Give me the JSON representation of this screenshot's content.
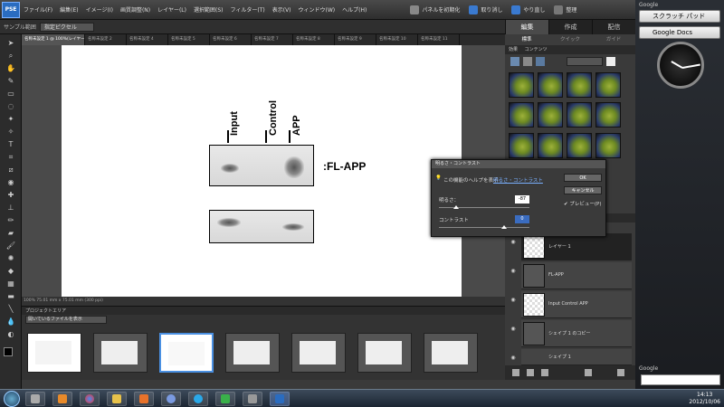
{
  "app": {
    "logo": "PSE",
    "menus": [
      "ファイル(F)",
      "編集(E)",
      "イメージ(I)",
      "画質調整(N)",
      "レイヤー(L)",
      "選択範囲(S)",
      "フィルター(T)",
      "表示(V)",
      "ウィンドウ(W)",
      "ヘルプ(H)"
    ],
    "toolbar_buttons": [
      "パネルを初期化",
      "取り消し",
      "やり直し",
      "整理"
    ],
    "options_label": "サンプル範囲",
    "options_value": "指定ピクセル",
    "tabs": [
      "名称未設定 1 @ 100%(レイヤー 1, グレー/8)",
      "名称未設定 2",
      "名称未設定 4",
      "名称未設定 5",
      "名称未設定 6",
      "名称未設定 7",
      "名称未設定 8",
      "名称未設定 9",
      "名称未設定 10",
      "名称未設定 11"
    ],
    "status": "100%    75.01 mm x 75.01 mm (300 ppi)"
  },
  "blot": {
    "lanes": [
      "Input",
      "Control",
      "APP"
    ],
    "label": ":FL-APP"
  },
  "bin": {
    "header": "プロジェクトエリア",
    "select": "開いているファイルを表示"
  },
  "panel": {
    "tabs": [
      "編集",
      "作成",
      "配信"
    ],
    "subtabs": [
      "標準",
      "クイック",
      "ガイド"
    ],
    "effects_header": "効果",
    "effects_sub": "コンテンツ",
    "layers": [
      "レイヤー 1",
      "FL-APP",
      "Input Control APP",
      "シェイプ 1 のコピー",
      "シェイプ 1"
    ]
  },
  "dialog": {
    "title": "明るさ・コントラスト",
    "help": "この機能のヘルプを表示",
    "help_link": "明るさ・コントラスト",
    "ok": "OK",
    "cancel": "キャンセル",
    "preview": "プレビュー(P)",
    "brightness_label": "明るさ：",
    "brightness_value": "-87",
    "contrast_label": "コントラスト",
    "contrast_value": "0"
  },
  "sidebar": {
    "gadget_title": "Google",
    "scratch": "スクラッチ パッド",
    "docs": "Google Docs",
    "search_title": "Google"
  },
  "tray": {
    "time": "14:13",
    "date": "2012/10/06"
  },
  "colors": {
    "accent": "#4a90e2",
    "photoshop_blue": "#2a6cc0"
  }
}
